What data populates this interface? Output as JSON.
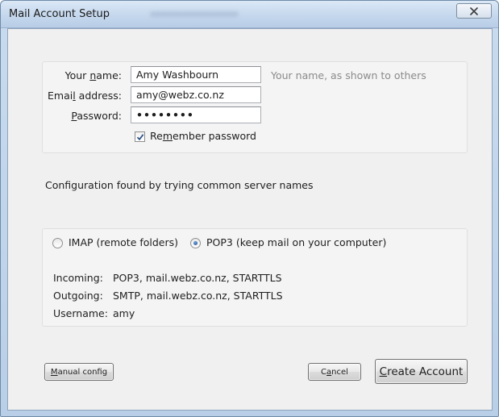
{
  "window": {
    "title": "Mail Account Setup",
    "close_label": "✕"
  },
  "identity": {
    "name_label_pre": "Your ",
    "name_label_key": "n",
    "name_label_post": "ame:",
    "name_value": "Amy Washbourn",
    "name_hint": "Your name, as shown to others",
    "email_label_pre": "Emai",
    "email_label_key": "l",
    "email_label_post": " address:",
    "email_value": "amy@webz.co.nz",
    "password_label_pre": "",
    "password_label_key": "P",
    "password_label_post": "assword:",
    "password_value": "••••••••",
    "remember_label_pre": "Re",
    "remember_label_key": "m",
    "remember_label_post": "ember password",
    "remember_checked": true
  },
  "status": {
    "message": "Configuration found by trying common server names"
  },
  "protocol": {
    "imap_label": "IMAP (remote folders)",
    "pop3_label": "POP3 (keep mail on your computer)",
    "selected": "pop3"
  },
  "server_details": {
    "incoming_label": "Incoming:",
    "incoming_value": "POP3, mail.webz.co.nz, STARTTLS",
    "outgoing_label": "Outgoing:",
    "outgoing_value": "SMTP, mail.webz.co.nz, STARTTLS",
    "username_label": "Username:",
    "username_value": "amy"
  },
  "actions": {
    "manual_config_key": "M",
    "manual_config_rest": "anual config",
    "cancel_pre": "C",
    "cancel_key": "a",
    "cancel_post": "ncel",
    "create_key": "C",
    "create_rest": "reate Account"
  }
}
